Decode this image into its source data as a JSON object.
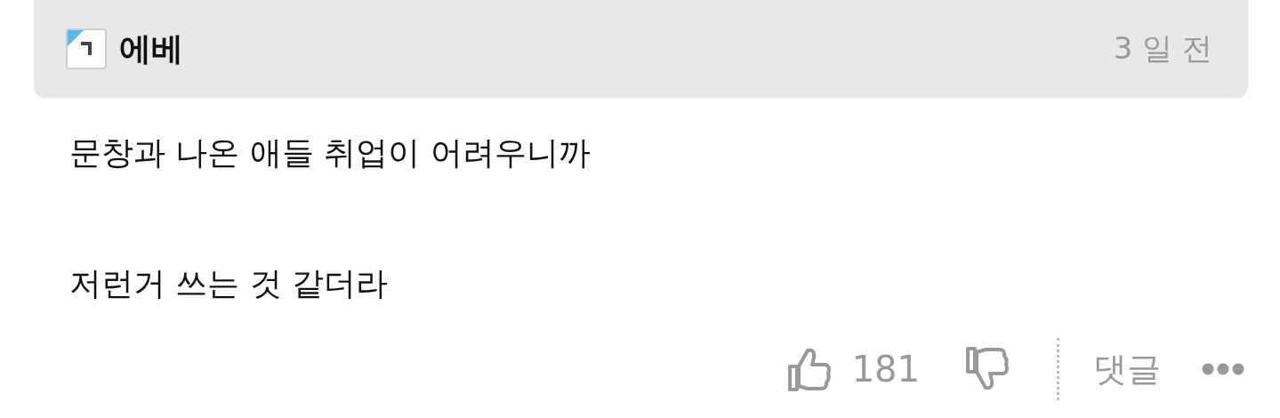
{
  "comment": {
    "author": "에베",
    "time": "3 일 전",
    "paragraphs": [
      "문창과 나온 애들 취업이 어려우니까",
      "저런거 쓰는 것 같더라"
    ],
    "likes": "181",
    "reply_label": "댓글"
  }
}
